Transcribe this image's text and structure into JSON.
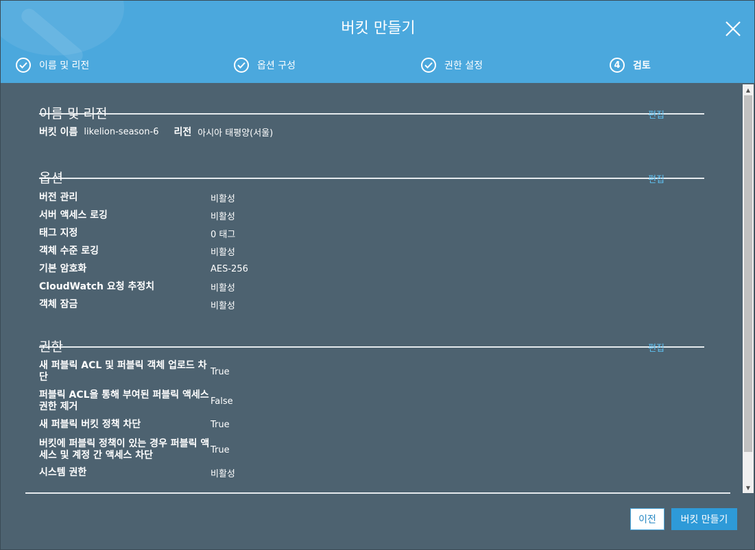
{
  "dialog": {
    "title": "버킷 만들기",
    "close_icon": "close-icon"
  },
  "steps": [
    {
      "label": "이름 및 리전",
      "state": "done"
    },
    {
      "label": "옵션 구성",
      "state": "done"
    },
    {
      "label": "권한 설정",
      "state": "done"
    },
    {
      "label": "검토",
      "state": "current",
      "number": "4"
    }
  ],
  "sections": {
    "name_region": {
      "title": "이름 및 리전",
      "edit": "편집",
      "bucket_name_label": "버킷 이름",
      "bucket_name_value": "likelion-season-6",
      "region_label": "리전",
      "region_value": "아시아 태평양(서울)"
    },
    "options": {
      "title": "옵션",
      "edit": "편집",
      "rows": [
        {
          "key": "버전 관리",
          "value": "비활성"
        },
        {
          "key": "서버 액세스 로깅",
          "value": "비활성"
        },
        {
          "key": "태그 지정",
          "value": "0 태그"
        },
        {
          "key": "객체 수준 로깅",
          "value": "비활성"
        },
        {
          "key": "기본 암호화",
          "value": "AES-256"
        },
        {
          "key": "CloudWatch 요청 추정치",
          "value": "비활성"
        },
        {
          "key": "객체 잠금",
          "value": "비활성"
        }
      ]
    },
    "permissions": {
      "title": "권한",
      "edit": "편집",
      "rows": [
        {
          "key": "새 퍼블릭 ACL 및 퍼블릭 객체 업로드 차단",
          "value": "True"
        },
        {
          "key": "퍼블릭 ACL을 통해 부여된 퍼블릭 액세스 권한 제거",
          "value": "False"
        },
        {
          "key": "새 퍼블릭 버킷 정책 차단",
          "value": "True"
        },
        {
          "key": "버킷에 퍼블릭 정책이 있는 경우 퍼블릭 액세스 및 계정 간 액세스 차단",
          "value": "True"
        },
        {
          "key": "시스템 권한",
          "value": "비활성"
        }
      ]
    }
  },
  "footer": {
    "prev_label": "이전",
    "create_label": "버킷 만들기"
  },
  "colors": {
    "header": "#4ba8dd",
    "body": "#4d6270",
    "link": "#5fc0f0",
    "primary_button": "#2e9ad8"
  }
}
